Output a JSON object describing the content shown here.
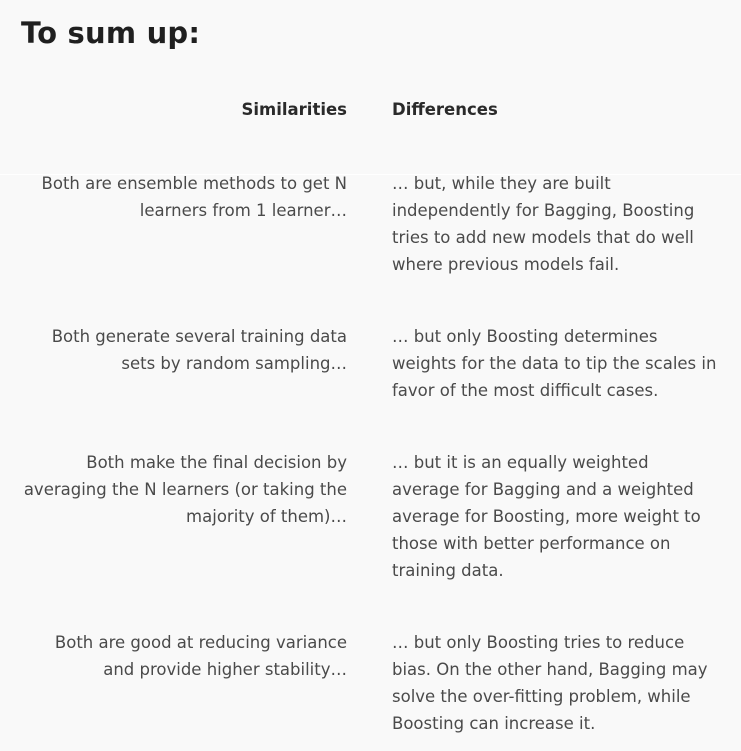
{
  "title": "To sum up:",
  "headers": {
    "similarities": "Similarities",
    "differences": "Differences"
  },
  "rows": [
    {
      "similarity": "Both are ensemble methods to get N learners from 1 learner…",
      "difference": "… but, while they are built independently for Bagging, Boosting tries to add new models that do well where previous models fail."
    },
    {
      "similarity": "Both generate several training data sets by random sampling…",
      "difference": "… but only Boosting determines weights for the data to tip the scales in favor of the most difficult cases."
    },
    {
      "similarity": "Both make the final decision by averaging  the N learners (or taking the majority of them)…",
      "difference": "… but it is an equally weighted average for Bagging and a weighted average for Boosting, more weight to those with better performance on training data."
    },
    {
      "similarity": "Both are good at reducing variance and provide higher stability…",
      "difference": "… but only Boosting tries to reduce bias. On the other hand, Bagging may solve the over-fitting problem, while Boosting can increase it."
    }
  ]
}
